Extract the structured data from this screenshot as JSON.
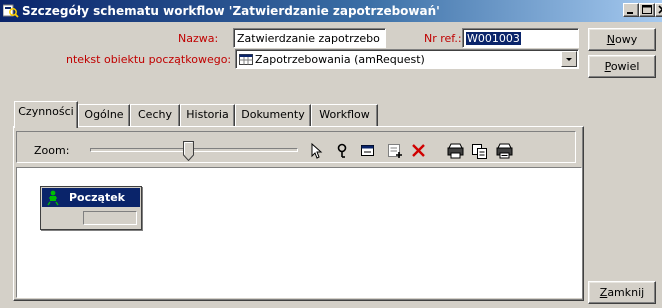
{
  "window": {
    "title": "Szczegóły schematu workflow 'Zatwierdzanie zapotrzebowań'",
    "app_icon": "workflow-details-icon",
    "controls": [
      "minimize-icon",
      "maximize-icon",
      "close-icon"
    ]
  },
  "form": {
    "name_label": "Nazwa:",
    "name_value": "Zatwierdzanie zapotrzebo",
    "ref_label": "Nr ref.:",
    "ref_value": "W001003",
    "context_label": "ntekst obiektu początkowego:",
    "context_value": "Zapotrzebowania (amRequest)",
    "context_icon": "table-icon"
  },
  "buttons": {
    "new": "Nowy",
    "duplicate": "Powiel",
    "close": "Zamknij"
  },
  "tabs": [
    {
      "label": "Czynności",
      "active": true
    },
    {
      "label": "Ogólne"
    },
    {
      "label": "Cechy"
    },
    {
      "label": "Historia"
    },
    {
      "label": "Dokumenty"
    },
    {
      "label": "Workflow"
    }
  ],
  "toolbar": {
    "zoom_label": "Zoom:",
    "tools": [
      "pointer-icon",
      "link-tool-icon",
      "activity-box-icon",
      "add-activity-icon",
      "delete-icon",
      "print-icon",
      "copy-icon",
      "print-preview-icon"
    ]
  },
  "canvas": {
    "node_title": "Początek",
    "node_icon": "traffic-light-icon"
  },
  "colors": {
    "label_red": "#c00000",
    "titlebar_blue": "#0a246a",
    "selection_blue": "#0a246a",
    "face_grey": "#d4d0c8"
  }
}
